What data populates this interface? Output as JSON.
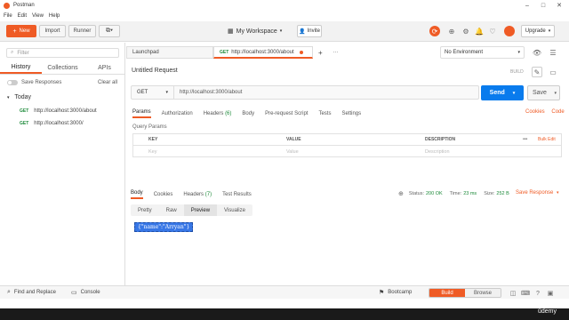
{
  "window": {
    "title": "Postman"
  },
  "menu": [
    "File",
    "Edit",
    "View",
    "Help"
  ],
  "header": {
    "new_label": "New",
    "import_label": "Import",
    "runner_label": "Runner",
    "workspace_label": "My Workspace",
    "invite_label": "Invite",
    "upgrade_label": "Upgrade"
  },
  "sidebar": {
    "filter_placeholder": "Filter",
    "tabs": [
      "History",
      "Collections",
      "APIs"
    ],
    "save_responses_label": "Save Responses",
    "clear_all_label": "Clear all",
    "group_label": "Today",
    "history": [
      {
        "method": "GET",
        "url": "http://localhost:3000/about"
      },
      {
        "method": "GET",
        "url": "http://localhost:3000/"
      }
    ]
  },
  "request_tabs": {
    "launchpad_label": "Launchpad",
    "active_method": "GET",
    "active_url": "http://localhost:3000/about",
    "add_label": "+",
    "more_label": "···"
  },
  "environment": {
    "selected": "No Environment"
  },
  "request": {
    "title": "Untitled Request",
    "build_label": "BUILD",
    "method": "GET",
    "url": "http://localhost:3000/about",
    "send_label": "Send",
    "save_label": "Save",
    "tabs": [
      {
        "label": "Params",
        "count": ""
      },
      {
        "label": "Authorization",
        "count": ""
      },
      {
        "label": "Headers",
        "count": "(6)"
      },
      {
        "label": "Body",
        "count": ""
      },
      {
        "label": "Pre-request Script",
        "count": ""
      },
      {
        "label": "Tests",
        "count": ""
      },
      {
        "label": "Settings",
        "count": ""
      }
    ],
    "cookies_label": "Cookies",
    "code_label": "Code",
    "query_params_label": "Query Params",
    "table": {
      "headers": [
        "KEY",
        "VALUE",
        "DESCRIPTION"
      ],
      "placeholders": [
        "Key",
        "Value",
        "Description"
      ],
      "more_label": "•••",
      "bulk_edit_label": "Bulk Edit"
    }
  },
  "response": {
    "tabs": [
      {
        "label": "Body",
        "count": ""
      },
      {
        "label": "Cookies",
        "count": ""
      },
      {
        "label": "Headers",
        "count": "(7)"
      },
      {
        "label": "Test Results",
        "count": ""
      }
    ],
    "status_label": "Status:",
    "status_value": "200 OK",
    "time_label": "Time:",
    "time_value": "23 ms",
    "size_label": "Size:",
    "size_value": "252 B",
    "save_response_label": "Save Response",
    "view_tabs": [
      "Pretty",
      "Raw",
      "Preview",
      "Visualize"
    ],
    "body": "{\"name\":\"Arryan\"}"
  },
  "statusbar": {
    "find_replace_label": "Find and Replace",
    "console_label": "Console",
    "bootcamp_label": "Bootcamp",
    "build_label": "Build",
    "browse_label": "Browse"
  },
  "watermark": "ûdemy",
  "colors": {
    "accent": "#ef5b25",
    "send": "#097bed",
    "success": "#1d8a3a"
  }
}
